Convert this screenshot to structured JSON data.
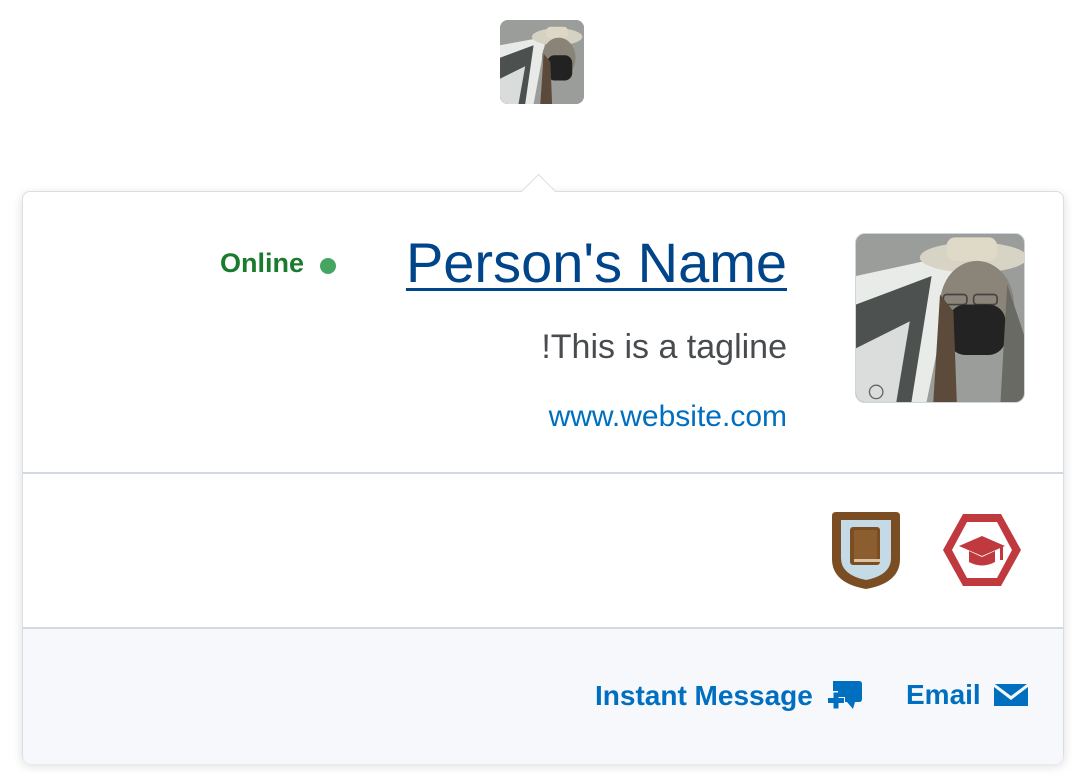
{
  "profile": {
    "status": "Online",
    "name": "Person's Name",
    "tagline": "!This is a tagline",
    "website": "www.website.com"
  },
  "avatar": {
    "alt": "Profile photo"
  },
  "badges": [
    {
      "icon": "book-badge-icon",
      "color": "#7a4e22"
    },
    {
      "icon": "graduation-cap-badge-icon",
      "color": "#c0393f"
    }
  ],
  "actions": {
    "instant_message": "Instant Message",
    "email": "Email"
  },
  "colors": {
    "link": "#006fbf",
    "name": "#004489",
    "online": "#197b2c"
  }
}
